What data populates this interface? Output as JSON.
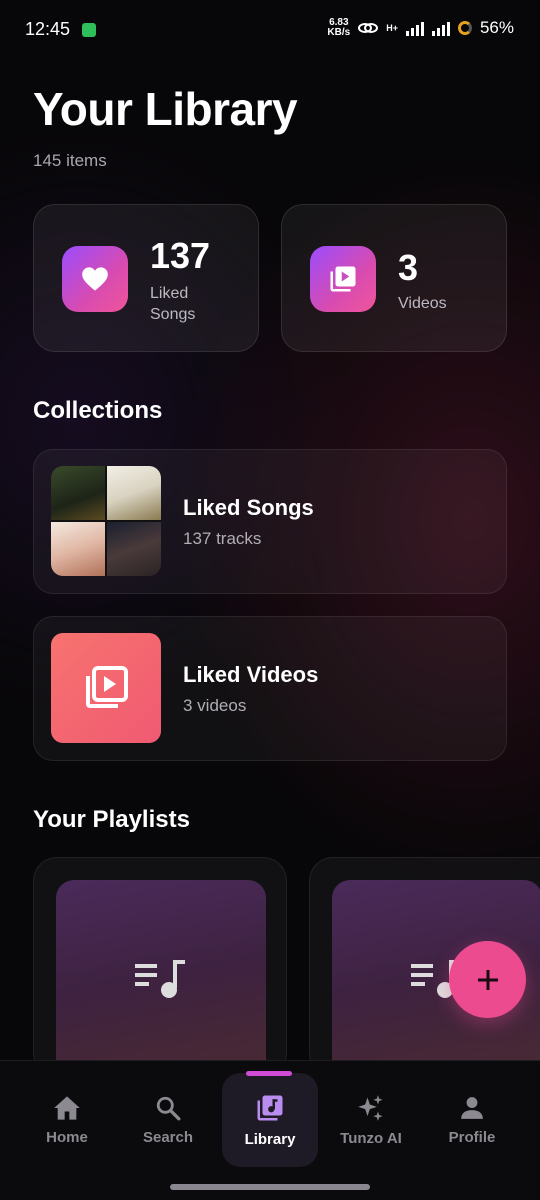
{
  "status_bar": {
    "time": "12:45",
    "net_speed_value": "6.83",
    "net_speed_unit": "KB/s",
    "network_type": "H+",
    "battery": "56%"
  },
  "header": {
    "title": "Your Library",
    "item_count": "145 items"
  },
  "stats": [
    {
      "number": "137",
      "label_line1": "Liked",
      "label_line2": "Songs",
      "icon": "heart-icon"
    },
    {
      "number": "3",
      "label_line1": "Videos",
      "label_line2": "",
      "icon": "video-library-icon"
    }
  ],
  "collections": {
    "title": "Collections",
    "items": [
      {
        "title": "Liked Songs",
        "subtitle": "137 tracks",
        "art": "album-collage"
      },
      {
        "title": "Liked Videos",
        "subtitle": "3 videos",
        "art": "video-library-icon"
      }
    ]
  },
  "playlists": {
    "title": "Your Playlists",
    "icon": "playlist-music-icon"
  },
  "fab": {
    "icon": "plus-icon"
  },
  "bottom_nav": {
    "items": [
      {
        "label": "Home",
        "icon": "home-icon",
        "active": false
      },
      {
        "label": "Search",
        "icon": "search-icon",
        "active": false
      },
      {
        "label": "Library",
        "icon": "library-music-icon",
        "active": true
      },
      {
        "label": "Tunzo AI",
        "icon": "sparkles-icon",
        "active": false
      },
      {
        "label": "Profile",
        "icon": "person-icon",
        "active": false
      }
    ]
  },
  "colors": {
    "accent_gradient_start": "#9b4dff",
    "accent_gradient_end": "#f0559b",
    "liked_videos": "#f26a70",
    "fab": "#ec4b8f",
    "background": "#070608"
  }
}
